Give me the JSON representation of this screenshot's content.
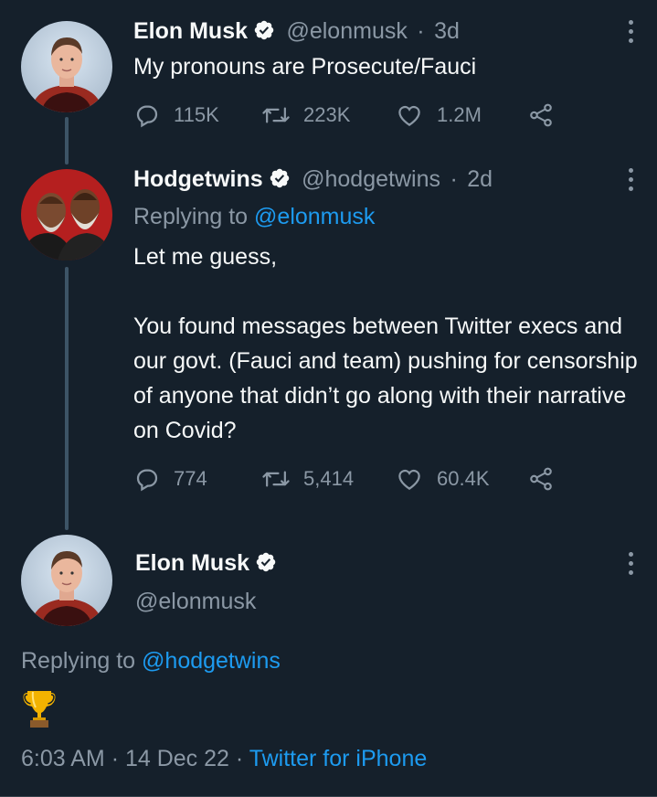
{
  "tweet1": {
    "name": "Elon Musk",
    "handle": "@elonmusk",
    "time": "3d",
    "text": "My pronouns are Prosecute/Fauci",
    "replies": "115K",
    "retweets": "223K",
    "likes": "1.2M"
  },
  "tweet2": {
    "name": "Hodgetwins",
    "handle": "@hodgetwins",
    "time": "2d",
    "replying_prefix": "Replying to",
    "replying_to": "@elonmusk",
    "text_line1": "Let me guess,",
    "text_para": "You found messages between Twitter execs and our govt. (Fauci and team) pushing for censorship of anyone that didn’t go along with their narrative on Covid?",
    "replies": "774",
    "retweets": "5,414",
    "likes": "60.4K"
  },
  "tweet3": {
    "name": "Elon Musk",
    "handle": "@elonmusk",
    "replying_prefix": "Replying to",
    "replying_to": "@hodgetwins",
    "emoji": "🏆",
    "time": "6:03 AM",
    "date": "14 Dec 22",
    "source": "Twitter for iPhone"
  },
  "separator": "·",
  "colors": {
    "background": "#15202b",
    "text": "#f7f9f9",
    "muted": "#8b98a5",
    "link": "#1d9bf0",
    "thread_line": "#3d5466"
  }
}
